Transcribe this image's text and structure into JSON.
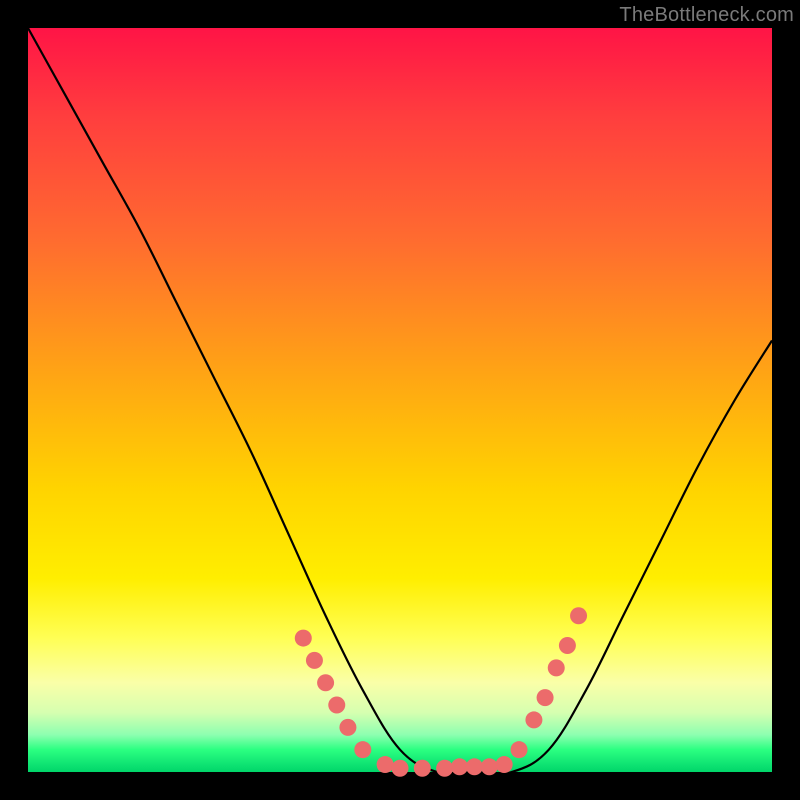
{
  "watermark": "TheBottleneck.com",
  "colors": {
    "background": "#000000",
    "curve_stroke": "#000000",
    "dot_fill": "#ec6b6b"
  },
  "chart_data": {
    "type": "line",
    "title": "",
    "xlabel": "",
    "ylabel": "",
    "xlim": [
      0,
      100
    ],
    "ylim": [
      0,
      100
    ],
    "grid": false,
    "legend": false,
    "series": [
      {
        "name": "bottleneck-curve",
        "x": [
          0,
          5,
          10,
          15,
          20,
          25,
          30,
          35,
          40,
          45,
          50,
          55,
          60,
          65,
          70,
          75,
          80,
          85,
          90,
          95,
          100
        ],
        "values": [
          100,
          91,
          82,
          73,
          63,
          53,
          43,
          32,
          21,
          11,
          3,
          0,
          0,
          0,
          3,
          11,
          21,
          31,
          41,
          50,
          58
        ]
      }
    ],
    "dots": {
      "name": "highlight-points",
      "comment": "pink dots clustered near the trough of the curve",
      "x": [
        37,
        38.5,
        40,
        41.5,
        43,
        45,
        48,
        50,
        53,
        56,
        58,
        60,
        62,
        64,
        66,
        68,
        69.5,
        71,
        72.5,
        74
      ],
      "values": [
        18,
        15,
        12,
        9,
        6,
        3,
        1,
        0.5,
        0.5,
        0.5,
        0.7,
        0.7,
        0.7,
        1,
        3,
        7,
        10,
        14,
        17,
        21
      ]
    }
  }
}
